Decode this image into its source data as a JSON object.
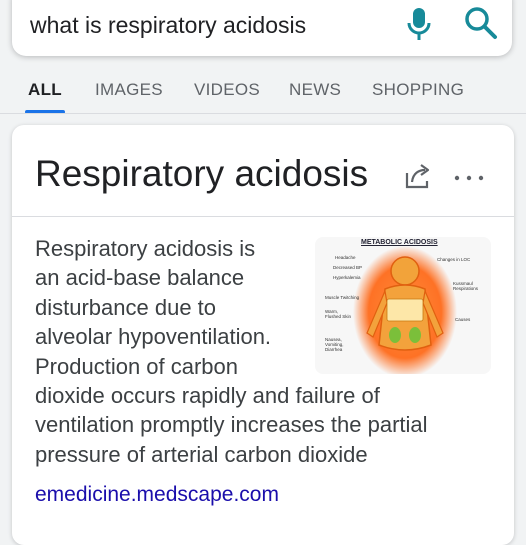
{
  "search": {
    "query": "what is respiratory acidosis"
  },
  "icons": {
    "mic": "microphone-icon",
    "search": "search-icon",
    "share": "share-icon",
    "more": "more-horizontal-icon"
  },
  "colors": {
    "accent": "#1a73e8",
    "mic_blue": "#4285f4",
    "link": "#1a0dab",
    "icon_teal": "#178a99"
  },
  "tabs": [
    {
      "label": "ALL",
      "active": true
    },
    {
      "label": "IMAGES"
    },
    {
      "label": "VIDEOS"
    },
    {
      "label": "NEWS"
    },
    {
      "label": "SHOPPING"
    }
  ],
  "card": {
    "title": "Respiratory acidosis",
    "snippet": [
      "Respiratory acidosis is",
      "an acid-base balance",
      "disturbance due to",
      "alveolar hypoventilation.",
      "Production of carbon",
      "dioxide occurs rapidly and failure of",
      "ventilation promptly increases the partial",
      "pressure of arterial carbon dioxide"
    ],
    "source": "emedicine.medscape.com",
    "image": {
      "title": "METABOLIC ACIDOSIS",
      "labels_left": [
        "Headache",
        "Decreased BP",
        "Hyperkalemia",
        "Muscle Twitching",
        "Warm, Flushed Skin",
        "Nausea, Vomiting, Diarrhea"
      ],
      "labels_right": [
        "Changes in LOC",
        "Kussmaul Respirations",
        "Causes"
      ]
    }
  }
}
